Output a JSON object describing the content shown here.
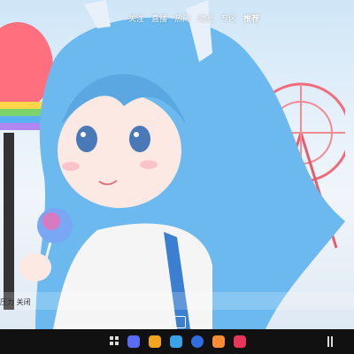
{
  "top_tabs": [
    "关注",
    "直播",
    "热门",
    "动漫",
    "专区",
    "推荐"
  ],
  "caption": "压力 关闭",
  "nav_apps": [
    {
      "icon": "browser-icon",
      "color": "#5a6cf6"
    },
    {
      "icon": "folder-icon",
      "color": "#f4a51e"
    },
    {
      "icon": "notes-icon",
      "color": "#3aa3e8"
    },
    {
      "icon": "messages-icon",
      "color": "#2f6de0"
    },
    {
      "icon": "gallery-icon",
      "color": "#ff8b34"
    },
    {
      "icon": "camera-icon",
      "color": "#e8365b"
    }
  ],
  "colors": {
    "accent": "#4aa3e6",
    "nav_bg": "#111111"
  }
}
